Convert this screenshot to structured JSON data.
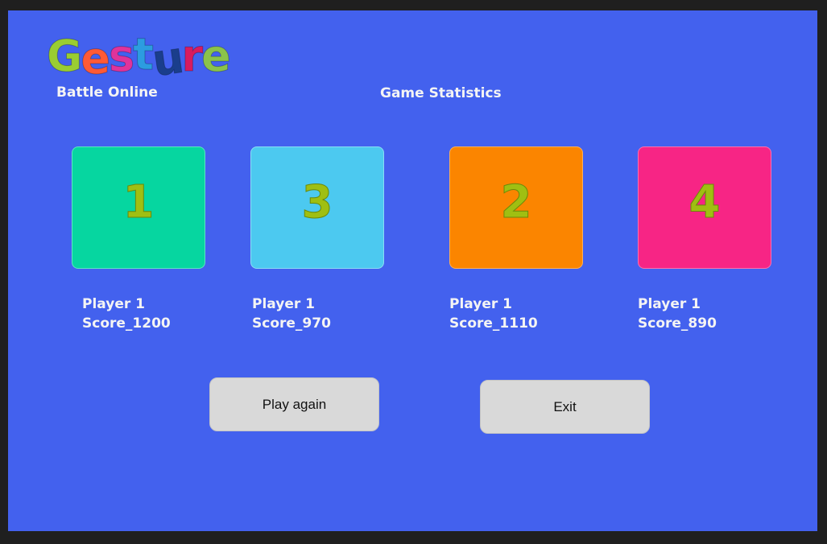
{
  "header": {
    "logo_letters": [
      "G",
      "e",
      "s",
      "t",
      "u",
      "r",
      "e"
    ],
    "subtitle": "Battle Online",
    "page_title": "Game Statistics"
  },
  "cards": [
    {
      "rank": "1",
      "color": "#06d6a0",
      "player": "Player 1",
      "score": "Score_1200"
    },
    {
      "rank": "3",
      "color": "#4cc9f0",
      "player": "Player 1",
      "score": "Score_970"
    },
    {
      "rank": "2",
      "color": "#fb8500",
      "player": "Player 1",
      "score": "Score_1110"
    },
    {
      "rank": "4",
      "color": "#f72585",
      "player": "Player 1",
      "score": "Score_890"
    }
  ],
  "buttons": {
    "play_again": "Play again",
    "exit": "Exit"
  },
  "colors": {
    "background": "#4361ee",
    "rank_text": "#9fbf12",
    "button_bg": "#d9d9d9"
  }
}
